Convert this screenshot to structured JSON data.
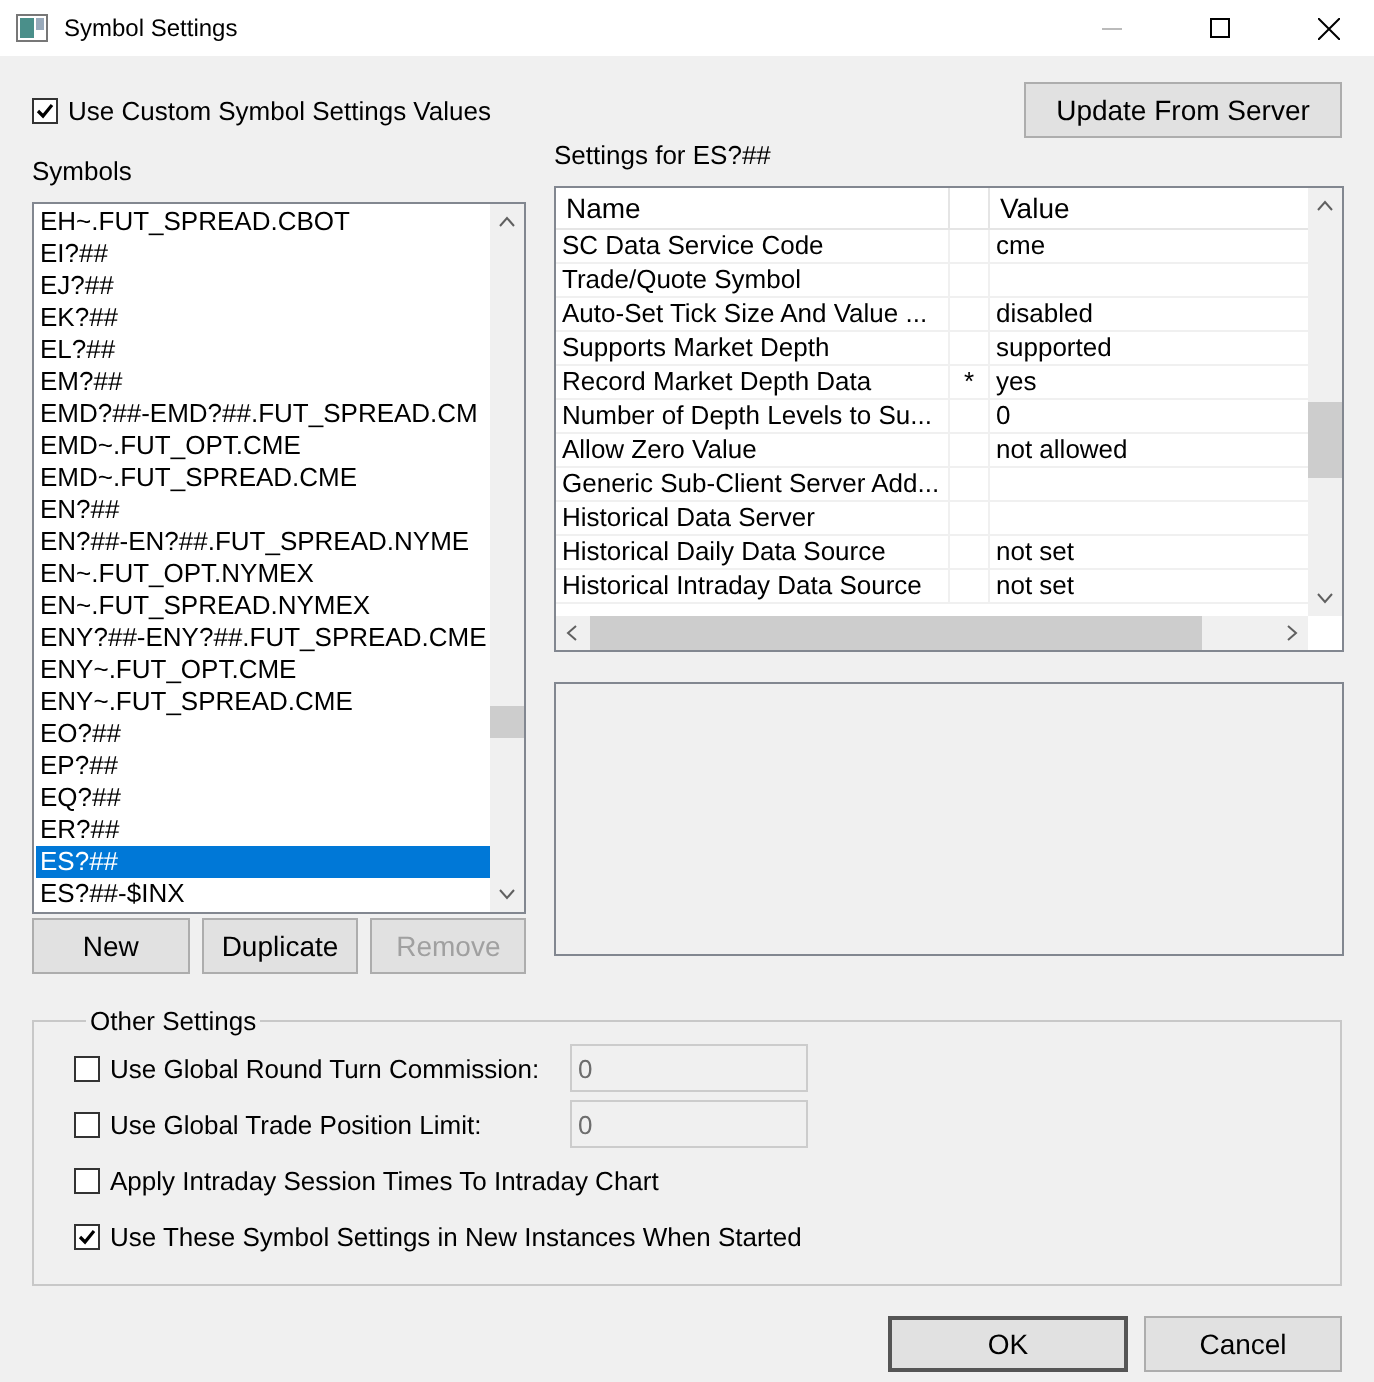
{
  "window": {
    "title": "Symbol Settings"
  },
  "custom_values": {
    "label": "Use Custom Symbol Settings Values",
    "checked": true
  },
  "update_button": "Update From Server",
  "symbols": {
    "label": "Symbols",
    "items": [
      {
        "text": "EH~.FUT_SPREAD.CBOT",
        "selected": false
      },
      {
        "text": "EI?##",
        "selected": false
      },
      {
        "text": "EJ?##",
        "selected": false
      },
      {
        "text": "EK?##",
        "selected": false
      },
      {
        "text": "EL?##",
        "selected": false
      },
      {
        "text": "EM?##",
        "selected": false
      },
      {
        "text": "EMD?##-EMD?##.FUT_SPREAD.CM",
        "selected": false
      },
      {
        "text": "EMD~.FUT_OPT.CME",
        "selected": false
      },
      {
        "text": "EMD~.FUT_SPREAD.CME",
        "selected": false
      },
      {
        "text": "EN?##",
        "selected": false
      },
      {
        "text": "EN?##-EN?##.FUT_SPREAD.NYME",
        "selected": false
      },
      {
        "text": "EN~.FUT_OPT.NYMEX",
        "selected": false
      },
      {
        "text": "EN~.FUT_SPREAD.NYMEX",
        "selected": false
      },
      {
        "text": "ENY?##-ENY?##.FUT_SPREAD.CME",
        "selected": false
      },
      {
        "text": "ENY~.FUT_OPT.CME",
        "selected": false
      },
      {
        "text": "ENY~.FUT_SPREAD.CME",
        "selected": false
      },
      {
        "text": "EO?##",
        "selected": false
      },
      {
        "text": "EP?##",
        "selected": false
      },
      {
        "text": "EQ?##",
        "selected": false
      },
      {
        "text": "ER?##",
        "selected": false
      },
      {
        "text": "ES?##",
        "selected": true
      },
      {
        "text": "ES?##-$INX",
        "selected": false
      }
    ]
  },
  "symbol_buttons": [
    {
      "label": "New",
      "disabled": false
    },
    {
      "label": "Duplicate",
      "disabled": false
    },
    {
      "label": "Remove",
      "disabled": true
    }
  ],
  "settings": {
    "title": "Settings for ES?##",
    "columns": [
      "Name",
      "Value"
    ],
    "rows": [
      {
        "name": "SC Data Service Code",
        "value": "cme"
      },
      {
        "name": "Trade/Quote Symbol"
      },
      {
        "name": "Auto-Set Tick Size And Value ...",
        "value": "disabled"
      },
      {
        "name": "Supports Market Depth",
        "value": "supported"
      },
      {
        "name": "Record Market Depth Data",
        "flag": "*",
        "value": "yes"
      },
      {
        "name": "Number of Depth Levels to Su...",
        "value": "0"
      },
      {
        "name": "Allow Zero Value",
        "value": "not allowed"
      },
      {
        "name": "Generic Sub-Client Server Add..."
      },
      {
        "name": "Historical Data Server"
      },
      {
        "name": "Historical Daily Data Source",
        "value": "not set"
      },
      {
        "name": "Historical Intraday Data Source",
        "value": "not set"
      }
    ]
  },
  "other_settings": {
    "title": "Other Settings",
    "options": [
      {
        "label": "Use Global Round Turn Commission:",
        "checked": false,
        "value": "0"
      },
      {
        "label": "Use Global Trade Position Limit:",
        "checked": false,
        "value": "0"
      },
      {
        "label": "Apply Intraday Session Times To Intraday Chart",
        "checked": false
      },
      {
        "label": "Use These Symbol Settings in New Instances When Started",
        "checked": true
      }
    ]
  },
  "buttons": [
    "OK",
    "Cancel"
  ]
}
